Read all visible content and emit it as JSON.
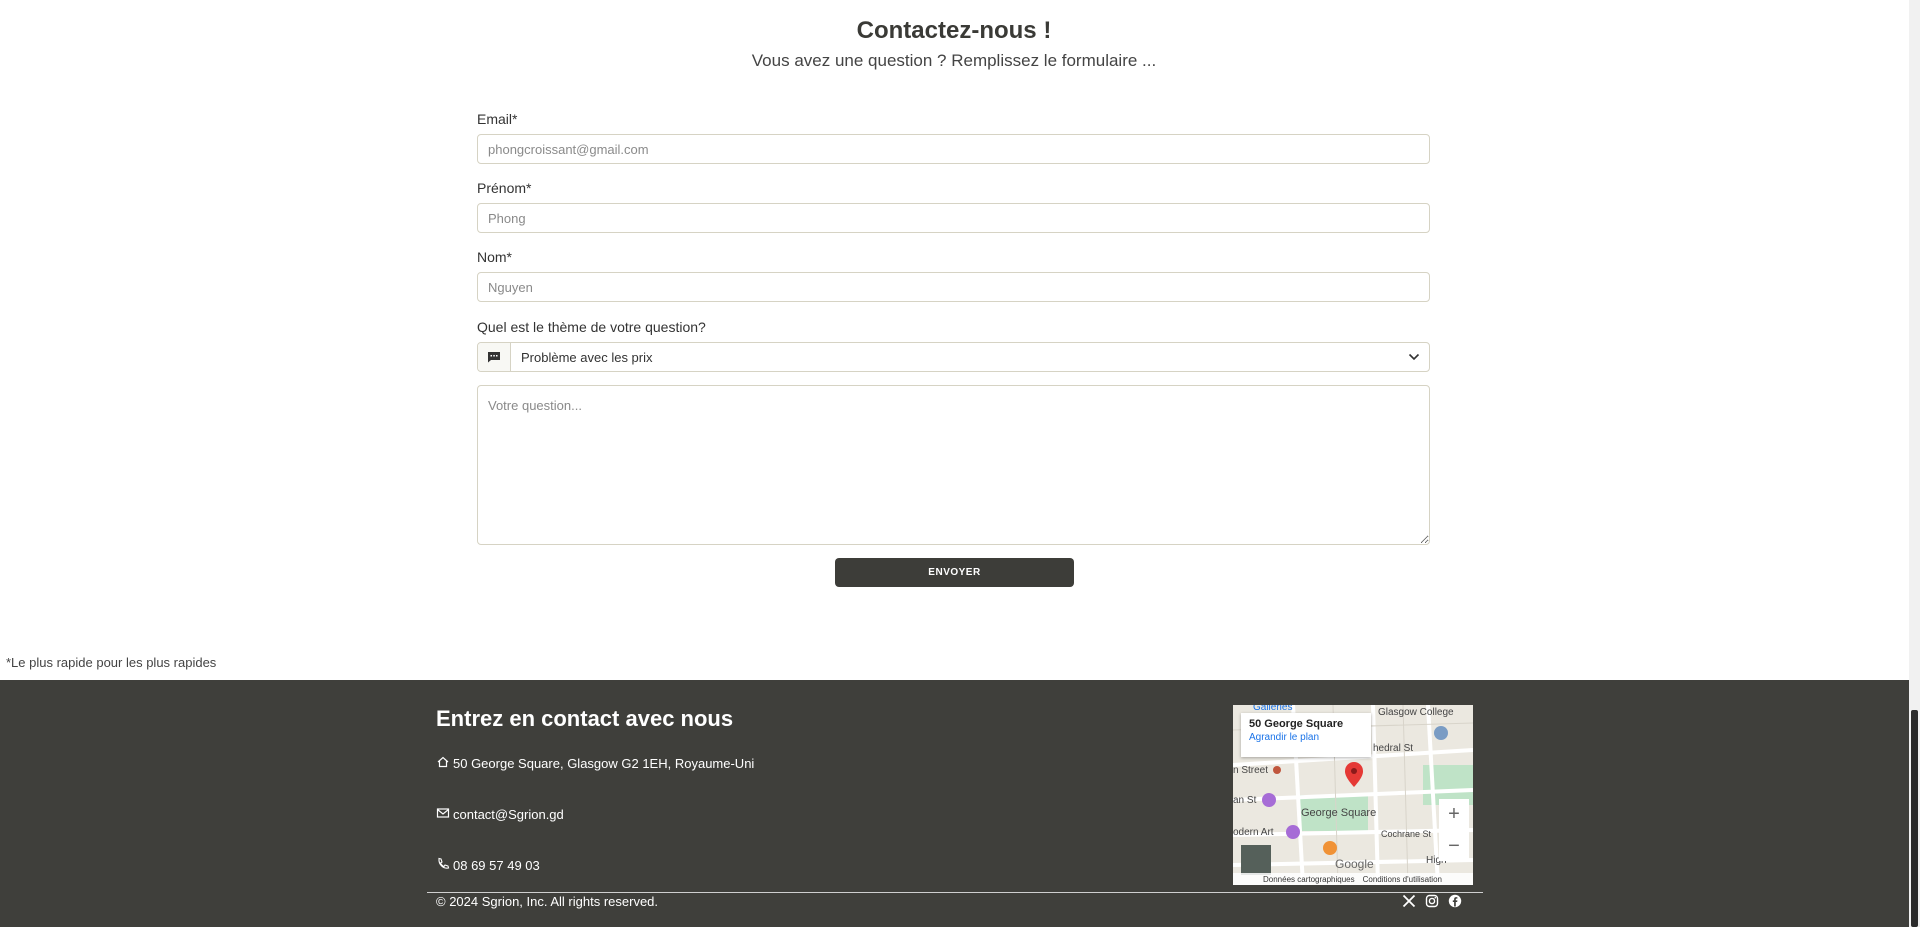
{
  "header": {
    "title": "Contactez-nous !",
    "subtitle": "Vous avez une question ? Remplissez le formulaire ..."
  },
  "form": {
    "email_label": "Email*",
    "email_placeholder": "phongcroissant@gmail.com",
    "firstname_label": "Prénom*",
    "firstname_placeholder": "Phong",
    "lastname_label": "Nom*",
    "lastname_placeholder": "Nguyen",
    "theme_label": "Quel est le thème de votre question?",
    "theme_value": "Problème avec les prix",
    "question_placeholder": "Votre question...",
    "submit_label": "ENVOYER"
  },
  "footnote": "*Le plus rapide pour les plus rapides",
  "footer": {
    "title": "Entrez en contact avec nous",
    "address": "50 George Square, Glasgow G2 1EH, Royaume-Uni",
    "email": "contact@Sgrion.gd",
    "phone": "08 69 57 49 03",
    "copyright": "© 2024 Sgrion, Inc. All rights reserved."
  },
  "map": {
    "card_title": "50 George Square",
    "card_link": "Agrandir le plan",
    "labels": [
      "Glasgow College",
      "hedral St",
      "n Street",
      "an St",
      "George Square",
      "odern Art",
      "Cochrane St",
      "High",
      "Galleries"
    ],
    "attribution": [
      "Données cartographiques",
      "Conditions d'utilisation"
    ],
    "google": "Google"
  },
  "colors": {
    "footer_bg": "#3f3f3b",
    "button_bg": "#3d3d39",
    "pin": "#e53935"
  }
}
